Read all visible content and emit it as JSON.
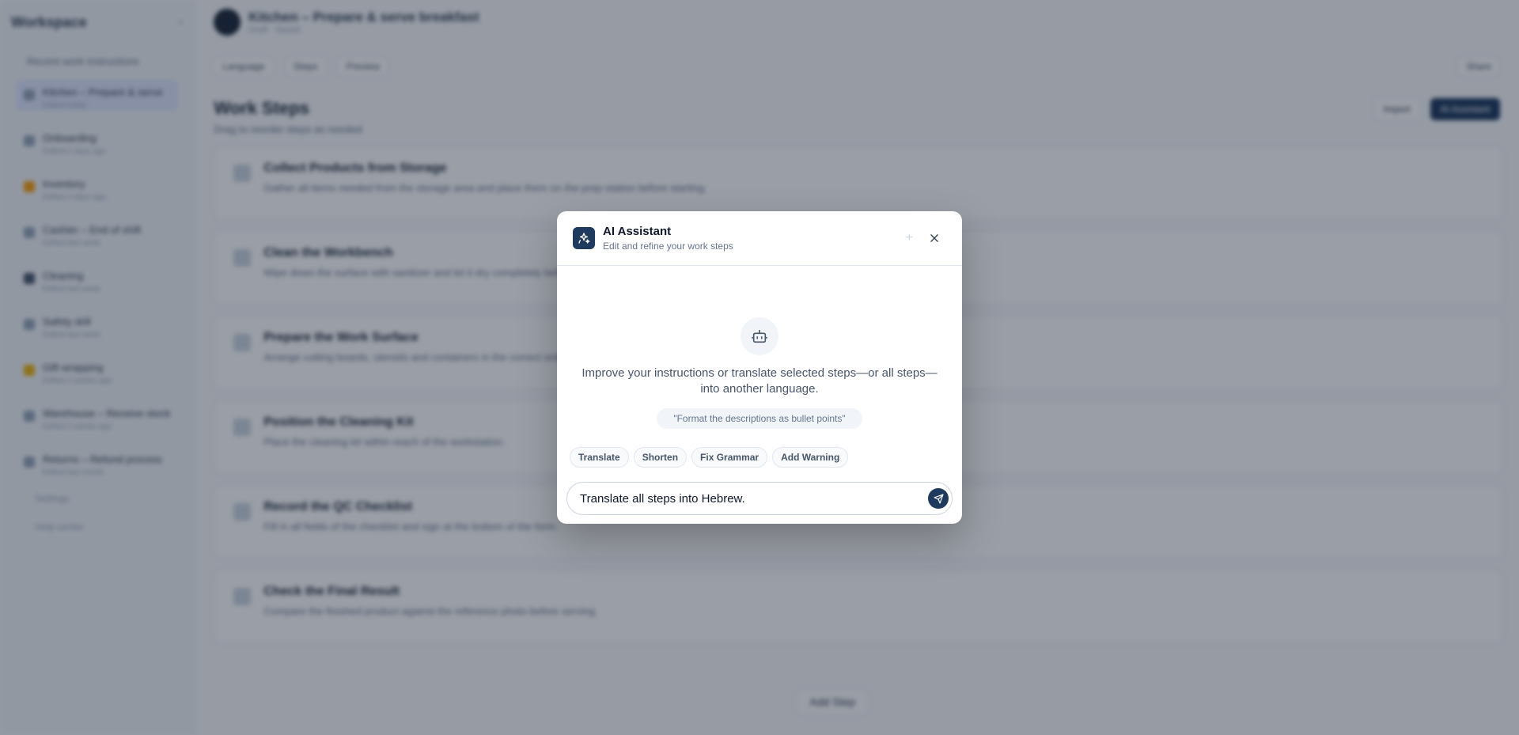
{
  "sidebar": {
    "brand": "Workspace",
    "section": "Recent work instructions",
    "items": [
      {
        "title": "Kitchen – Prepare & serve",
        "sub": "Edited today"
      },
      {
        "title": "Onboarding",
        "sub": "Edited 2 days ago"
      },
      {
        "title": "Inventory",
        "sub": "Edited 3 days ago"
      },
      {
        "title": "Cashier – End of shift",
        "sub": "Edited last week"
      },
      {
        "title": "Cleaning",
        "sub": "Edited last week"
      },
      {
        "title": "Safety drill",
        "sub": "Edited last week"
      },
      {
        "title": "Gift wrapping",
        "sub": "Edited 2 weeks ago"
      },
      {
        "title": "Warehouse – Receive stock",
        "sub": "Edited 2 weeks ago"
      },
      {
        "title": "Returns – Refund process",
        "sub": "Edited last month"
      }
    ],
    "footer": [
      "Settings",
      "Help center"
    ]
  },
  "header": {
    "title": "Kitchen – Prepare & serve breakfast",
    "subtitle": "Draft · Saved",
    "toolbar": [
      "Language",
      "Steps",
      "Preview"
    ],
    "share": "Share"
  },
  "steps_section": {
    "title": "Work Steps",
    "subtitle": "Drag to reorder steps as needed",
    "actions": [
      "Import",
      "AI Assistant"
    ],
    "steps": [
      {
        "title": "Collect Products from Storage",
        "desc": "Gather all items needed from the storage area and place them on the prep station before starting."
      },
      {
        "title": "Clean the Workbench",
        "desc": "Wipe down the surface with sanitizer and let it dry completely before use."
      },
      {
        "title": "Prepare the Work Surface",
        "desc": "Arrange cutting boards, utensils and containers in the correct order."
      },
      {
        "title": "Position the Cleaning Kit",
        "desc": "Place the cleaning kit within reach of the workstation."
      },
      {
        "title": "Record the QC Checklist",
        "desc": "Fill in all fields of the checklist and sign at the bottom of the form."
      },
      {
        "title": "Check the Final Result",
        "desc": "Compare the finished product against the reference photo before serving."
      }
    ],
    "add_step": "Add Step"
  },
  "modal": {
    "title": "AI Assistant",
    "subtitle": "Edit and refine your work steps",
    "message": "Improve your instructions or translate selected steps—or all steps—into another language.",
    "example": "\"Format the descriptions as bullet points\"",
    "chips": [
      "Translate",
      "Shorten",
      "Fix Grammar",
      "Add Warning"
    ],
    "input_value": "Translate all steps into Hebrew.",
    "accent": "#1e3a5f"
  }
}
